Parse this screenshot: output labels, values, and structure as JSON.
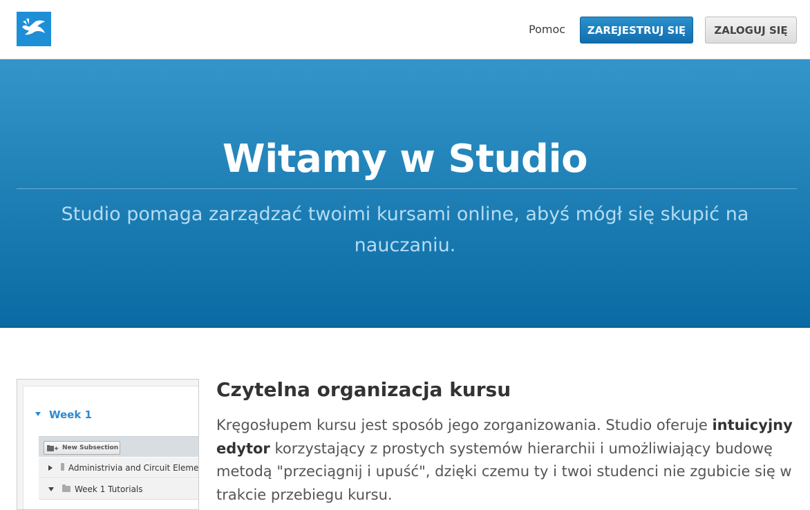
{
  "header": {
    "logo": "dove-logo-icon",
    "help_label": "Pomoc",
    "register_label": "ZAREJESTRUJ SIĘ",
    "login_label": "ZALOGUJ SIĘ"
  },
  "hero": {
    "title": "Witamy w Studio",
    "subtitle": "Studio pomaga zarządzać twoimi kursami online, abyś mógł się skupić na nauczaniu."
  },
  "feature": {
    "title": "Czytelna organizacja kursu",
    "text_before": "Kręgosłupem kursu jest sposób jego zorganizowania. Studio oferuje ",
    "text_bold": "intuicyjny edytor",
    "text_after": " korzystający z prostych systemów hierarchii i umożliwiający budowę metodą \"przeciągnij i upuść\", dzięki czemu ty i twoi studenci nie zgubicie się w trakcie przebiegu kursu.",
    "screenshot": {
      "week_label": "Week 1",
      "new_subsection_label": "New Subsection",
      "rows": [
        {
          "label": "Administrivia and Circuit Elements",
          "expanded": false
        },
        {
          "label": "Week 1 Tutorials",
          "expanded": true
        }
      ]
    }
  },
  "colors": {
    "hero_top": "#3395c9",
    "hero_bottom": "#0a6aa3",
    "primary_button": "#126eb0",
    "logo_bg": "#1e8fd6"
  }
}
